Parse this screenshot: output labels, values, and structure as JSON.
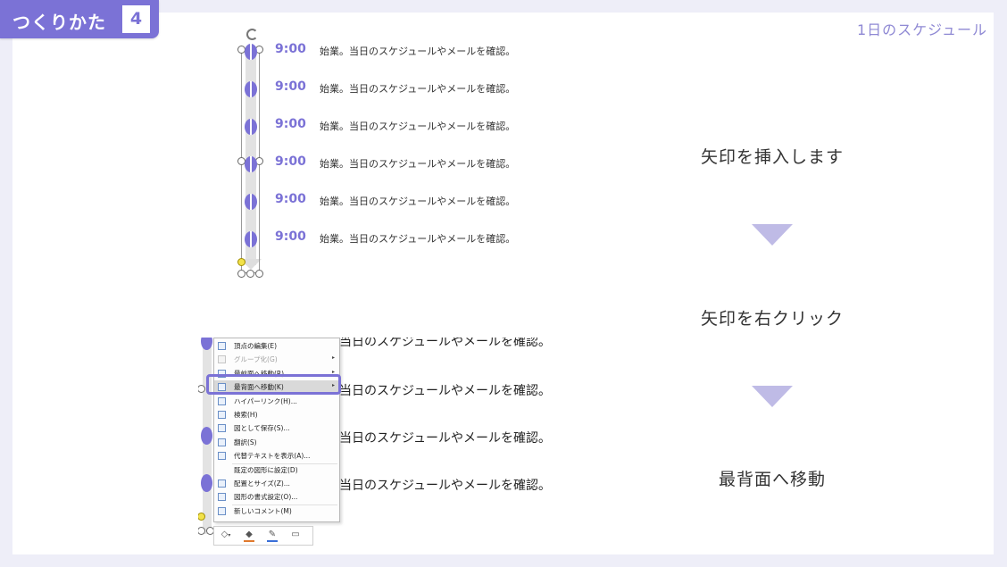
{
  "header": {
    "badge_text": "つくりかた",
    "badge_number": "4",
    "page_label": "1日のスケジュール"
  },
  "timeline_rows": [
    {
      "time": "9:00",
      "text": "始業。当日のスケジュールやメールを確認。"
    },
    {
      "time": "9:00",
      "text": "始業。当日のスケジュールやメールを確認。"
    },
    {
      "time": "9:00",
      "text": "始業。当日のスケジュールやメールを確認。"
    },
    {
      "time": "9:00",
      "text": "始業。当日のスケジュールやメールを確認。"
    },
    {
      "time": "9:00",
      "text": "始業。当日のスケジュールやメールを確認。"
    },
    {
      "time": "9:00",
      "text": "始業。当日のスケジュールやメールを確認。"
    }
  ],
  "steps": [
    "矢印を挿入します",
    "矢印を右クリック",
    "最背面へ移動"
  ],
  "lower_rows": [
    "当日のスケジュールやメールを確認。",
    "当日のスケジュールやメールを確認。",
    "当日のスケジュールやメールを確認。",
    "当日のスケジュールやメールを確認。"
  ],
  "context_menu": {
    "items": [
      {
        "label": "頂点の編集(E)",
        "icon": "edit-points-icon",
        "disabled": false,
        "submenu": false
      },
      {
        "label": "グループ化(G)",
        "icon": "group-icon",
        "disabled": true,
        "submenu": true
      },
      {
        "label": "最前面へ移動(R)",
        "icon": "bring-front-icon",
        "disabled": false,
        "submenu": true
      },
      {
        "label": "最背面へ移動(K)",
        "icon": "send-back-icon",
        "disabled": false,
        "submenu": true,
        "highlighted": true
      },
      {
        "label": "ハイパーリンク(H)...",
        "icon": "hyperlink-icon",
        "disabled": false,
        "submenu": false
      },
      {
        "label": "検索(H)",
        "icon": "search-icon",
        "disabled": false,
        "submenu": false
      },
      {
        "label": "図として保存(S)...",
        "icon": "save-picture-icon",
        "disabled": false,
        "submenu": false
      },
      {
        "label": "翻訳(S)",
        "icon": "translate-icon",
        "disabled": false,
        "submenu": false
      },
      {
        "label": "代替テキストを表示(A)...",
        "icon": "alt-text-icon",
        "disabled": false,
        "submenu": false
      },
      {
        "label": "既定の図形に設定(D)",
        "icon": "default-shape-icon",
        "disabled": false,
        "submenu": false
      },
      {
        "label": "配置とサイズ(Z)...",
        "icon": "size-position-icon",
        "disabled": false,
        "submenu": false
      },
      {
        "label": "図形の書式設定(O)...",
        "icon": "format-shape-icon",
        "disabled": false,
        "submenu": false
      },
      {
        "label": "新しいコメント(M)",
        "icon": "comment-icon",
        "disabled": false,
        "submenu": false
      }
    ]
  },
  "mini_toolbar": {
    "icons": [
      "shape-style-icon",
      "fill-color-icon",
      "outline-color-icon",
      "new-comment-icon"
    ],
    "colors": {
      "fill": "#e07a2e",
      "outline": "#3a6fd8"
    }
  },
  "colors": {
    "accent": "#7b72d6",
    "arrow": "#bfbbe6",
    "background": "#eeeef8"
  }
}
